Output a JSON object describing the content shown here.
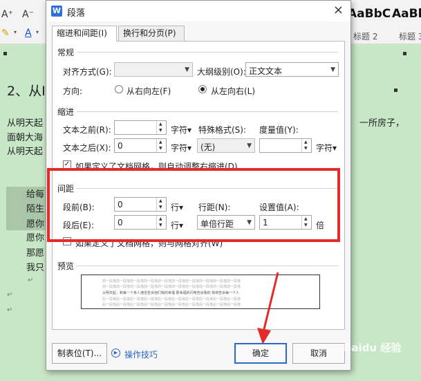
{
  "ribbon": {
    "font_tools": [
      "A⁺",
      "A⁻"
    ],
    "styles": [
      {
        "sample": "AaBbC",
        "name": "标题 2"
      },
      {
        "sample": "AaBb",
        "name": "标题 3"
      }
    ]
  },
  "document": {
    "heading": "2、从I",
    "lines": [
      {
        "left": "从明天起",
        "right": "一所房子，"
      },
      {
        "left": "面朝大海"
      },
      {
        "left": "从明天起"
      }
    ],
    "indented_lines": [
      "给每",
      "陌生",
      "愿你",
      "愿你",
      "那愿",
      "我只"
    ]
  },
  "dialog": {
    "title": "段落",
    "tabs": [
      {
        "label": "缩进和间距(I)",
        "active": true
      },
      {
        "label": "换行和分页(P)",
        "active": false
      }
    ],
    "general": {
      "title": "常规",
      "alignment_label": "对齐方式(G):",
      "alignment_value": "",
      "outline_label": "大纲级别(O):",
      "outline_value": "正文文本",
      "direction_label": "方向:",
      "rtl_label": "从右向左(F)",
      "ltr_label": "从左向右(L)",
      "direction_selected": "ltr"
    },
    "indent": {
      "title": "缩进",
      "before_label": "文本之前(R):",
      "before_value": "",
      "before_unit": "字符▾",
      "after_label": "文本之后(X):",
      "after_value": "0",
      "after_unit": "字符▾",
      "special_label": "特殊格式(S):",
      "special_value": "(无)",
      "measure_label": "度量值(Y):",
      "measure_value": "",
      "measure_unit": "字符▾",
      "grid_check_label": "如果定义了文档网格，则自动调整右缩进(D)",
      "grid_checked": true
    },
    "spacing": {
      "title": "间距",
      "before_label": "段前(B):",
      "before_value": "0",
      "before_unit": "行▾",
      "after_label": "段后(E):",
      "after_value": "0",
      "after_unit": "行▾",
      "line_label": "行距(N):",
      "line_value": "单倍行距",
      "setting_label": "设置值(A):",
      "setting_value": "1",
      "setting_unit": "倍",
      "grid_check_label": "如果定义了文档网格，则与网格对齐(W)",
      "grid_checked": false
    },
    "preview": {
      "title": "预览",
      "sample_before": "前一段落前一段落前一段落前一段落前一段落前一段落前一段落前一段落前一段落前一段落",
      "sample_main": "从明天起，和每一个亲人通信告诉他们我的幸福 那幸福的闪电告诉我的 我将告诉每一个人",
      "sample_after": "后一段落后一段落后一段落后一段落后一段落后一段落后一段落后一段落后一段落后一段落"
    },
    "buttons": {
      "tabs_button": "制表位(T)...",
      "tips": "操作技巧",
      "ok": "确定",
      "cancel": "取消"
    }
  },
  "watermark": "Baidu 经验"
}
